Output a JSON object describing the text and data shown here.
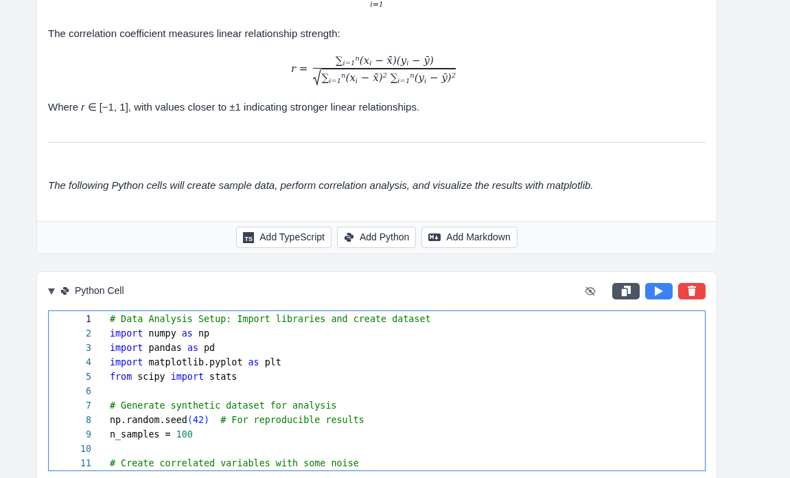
{
  "markdown_cell": {
    "prev_formula_tail": "i=1",
    "intro": "The correlation coefficient measures linear relationship strength:",
    "formula": {
      "lhs": "r =",
      "numerator": "∑$_{i=1}$$^{n}$(x$_{i}$ − x̄)(y$_{i}$ − ȳ)",
      "denominator": "∑$_{i=1}$$^{n}$(x$_{i}$ − x̄)$^{2}$ ∑$_{i=1}$$^{n}$(y$_{i}$ − ȳ)$^{2}$"
    },
    "note": "Where *r* ∈ [−1, 1], with values closer to ±1 indicating stronger linear relationships.",
    "closing": "The following Python cells will create sample data, perform correlation analysis, and visualize the results with matplotlib.",
    "add_buttons": [
      {
        "kind": "typescript",
        "icon_text": "TS",
        "label": "Add TypeScript"
      },
      {
        "kind": "python",
        "label": "Add Python"
      },
      {
        "kind": "markdown",
        "label": "Add Markdown"
      }
    ]
  },
  "python_cell": {
    "title": "Python Cell",
    "expanded": true,
    "lines": [
      {
        "number": "1",
        "current": true,
        "tokens": [
          {
            "kind": "comment",
            "text": "# Data Analysis Setup: Import libraries and create dataset"
          }
        ]
      },
      {
        "number": "2",
        "current": false,
        "tokens": [
          {
            "kind": "keyword",
            "text": "import"
          },
          {
            "kind": "plain",
            "text": " numpy "
          },
          {
            "kind": "keyword",
            "text": "as"
          },
          {
            "kind": "plain",
            "text": " np"
          }
        ]
      },
      {
        "number": "3",
        "current": false,
        "tokens": [
          {
            "kind": "keyword",
            "text": "import"
          },
          {
            "kind": "plain",
            "text": " pandas "
          },
          {
            "kind": "keyword",
            "text": "as"
          },
          {
            "kind": "plain",
            "text": " pd"
          }
        ]
      },
      {
        "number": "4",
        "current": false,
        "tokens": [
          {
            "kind": "keyword",
            "text": "import"
          },
          {
            "kind": "plain",
            "text": " matplotlib.pyplot "
          },
          {
            "kind": "keyword",
            "text": "as"
          },
          {
            "kind": "plain",
            "text": " plt"
          }
        ]
      },
      {
        "number": "5",
        "current": false,
        "tokens": [
          {
            "kind": "keyword",
            "text": "from"
          },
          {
            "kind": "plain",
            "text": " scipy "
          },
          {
            "kind": "keyword",
            "text": "import"
          },
          {
            "kind": "plain",
            "text": " stats"
          }
        ]
      },
      {
        "number": "6",
        "current": false
      },
      {
        "number": "7",
        "current": false,
        "tokens": [
          {
            "kind": "comment",
            "text": "# Generate synthetic dataset for analysis"
          }
        ]
      },
      {
        "number": "8",
        "current": false,
        "tokens": [
          {
            "kind": "plain",
            "text": "np.random.seed"
          },
          {
            "kind": "bracket",
            "text": "(42)"
          },
          {
            "kind": "comment",
            "text": "  # For reproducible results"
          }
        ]
      },
      {
        "number": "9",
        "current": false,
        "tokens": [
          {
            "kind": "plain",
            "text": "n_samples = "
          },
          {
            "kind": "number",
            "text": "100"
          }
        ]
      },
      {
        "number": "10",
        "current": false
      },
      {
        "number": "11",
        "current": false,
        "tokens": [
          {
            "kind": "comment",
            "text": "# Create correlated variables with some noise"
          }
        ]
      }
    ]
  }
}
